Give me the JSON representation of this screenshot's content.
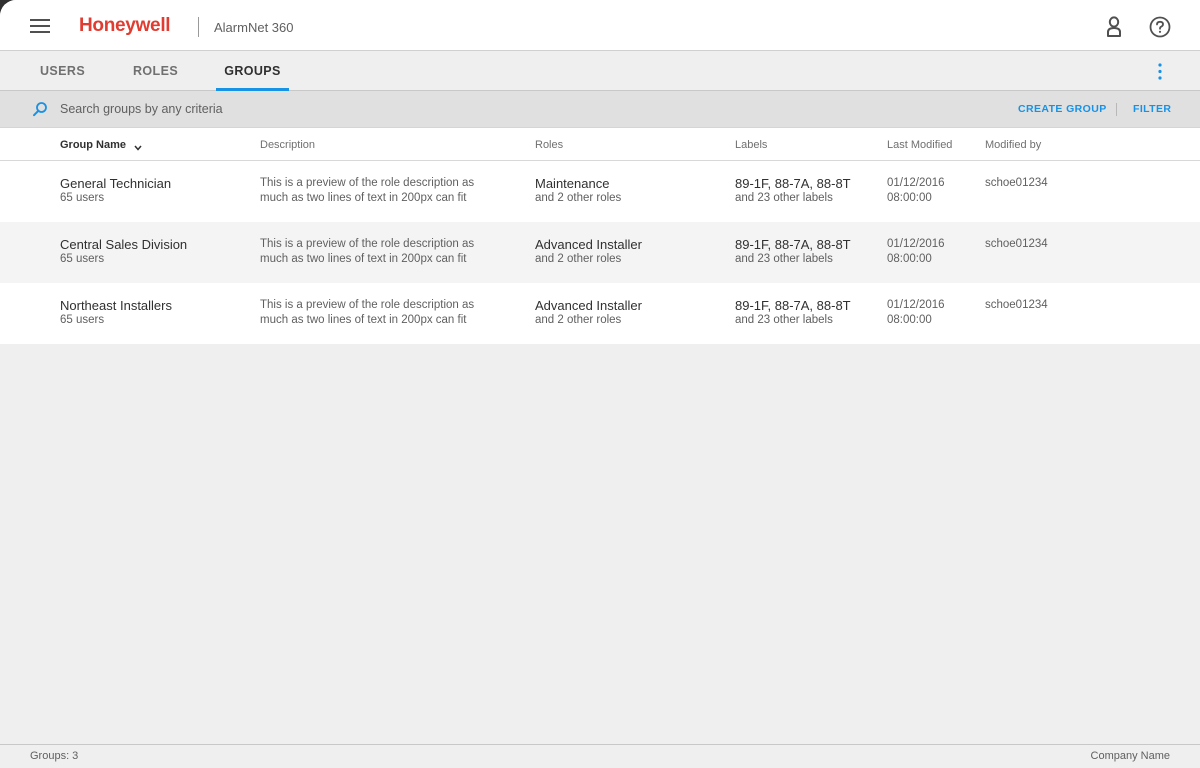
{
  "header": {
    "logo": "Honeywell",
    "app_name": "AlarmNet 360"
  },
  "tabs": [
    {
      "label": "USERS",
      "active": false
    },
    {
      "label": "ROLES",
      "active": false
    },
    {
      "label": "GROUPS",
      "active": true
    }
  ],
  "search": {
    "placeholder": "Search groups by any criteria",
    "create_label": "CREATE GROUP",
    "filter_label": "FILTER"
  },
  "table": {
    "columns": [
      "Group Name",
      "Description",
      "Roles",
      "Labels",
      "Last Modified",
      "Modified by"
    ],
    "rows": [
      {
        "name": "General Technician",
        "users": "65 users",
        "desc_line1": "This is a preview of the role description as",
        "desc_line2": "much as two lines of text in 200px can fit",
        "role": "Maintenance",
        "roles_more": "and 2 other roles",
        "labels": "89-1F, 88-7A, 88-8T",
        "labels_more": "and 23 other labels",
        "date": "01/12/2016",
        "time": "08:00:00",
        "modified_by": "schoe01234"
      },
      {
        "name": "Central Sales Division",
        "users": "65 users",
        "desc_line1": "This is a preview of the role description as",
        "desc_line2": "much as two lines of text in 200px can fit",
        "role": "Advanced Installer",
        "roles_more": "and 2 other roles",
        "labels": "89-1F, 88-7A, 88-8T",
        "labels_more": "and 23 other labels",
        "date": "01/12/2016",
        "time": "08:00:00",
        "modified_by": "schoe01234"
      },
      {
        "name": "Northeast Installers",
        "users": "65 users",
        "desc_line1": "This is a preview of the role description as",
        "desc_line2": "much as two lines of text in 200px can fit",
        "role": "Advanced Installer",
        "roles_more": "and 2 other roles",
        "labels": "89-1F, 88-7A, 88-8T",
        "labels_more": "and 23 other labels",
        "date": "01/12/2016",
        "time": "08:00:00",
        "modified_by": "schoe01234"
      }
    ]
  },
  "footer": {
    "count": "Groups: 3",
    "company": "Company Name"
  },
  "colors": {
    "brand": "#e03c31",
    "accent": "#1792e5",
    "background": "#efefef"
  },
  "icons": [
    "hamburger-menu-icon",
    "user-icon",
    "help-icon",
    "more-vert-icon",
    "search-icon",
    "sort-down-icon"
  ]
}
